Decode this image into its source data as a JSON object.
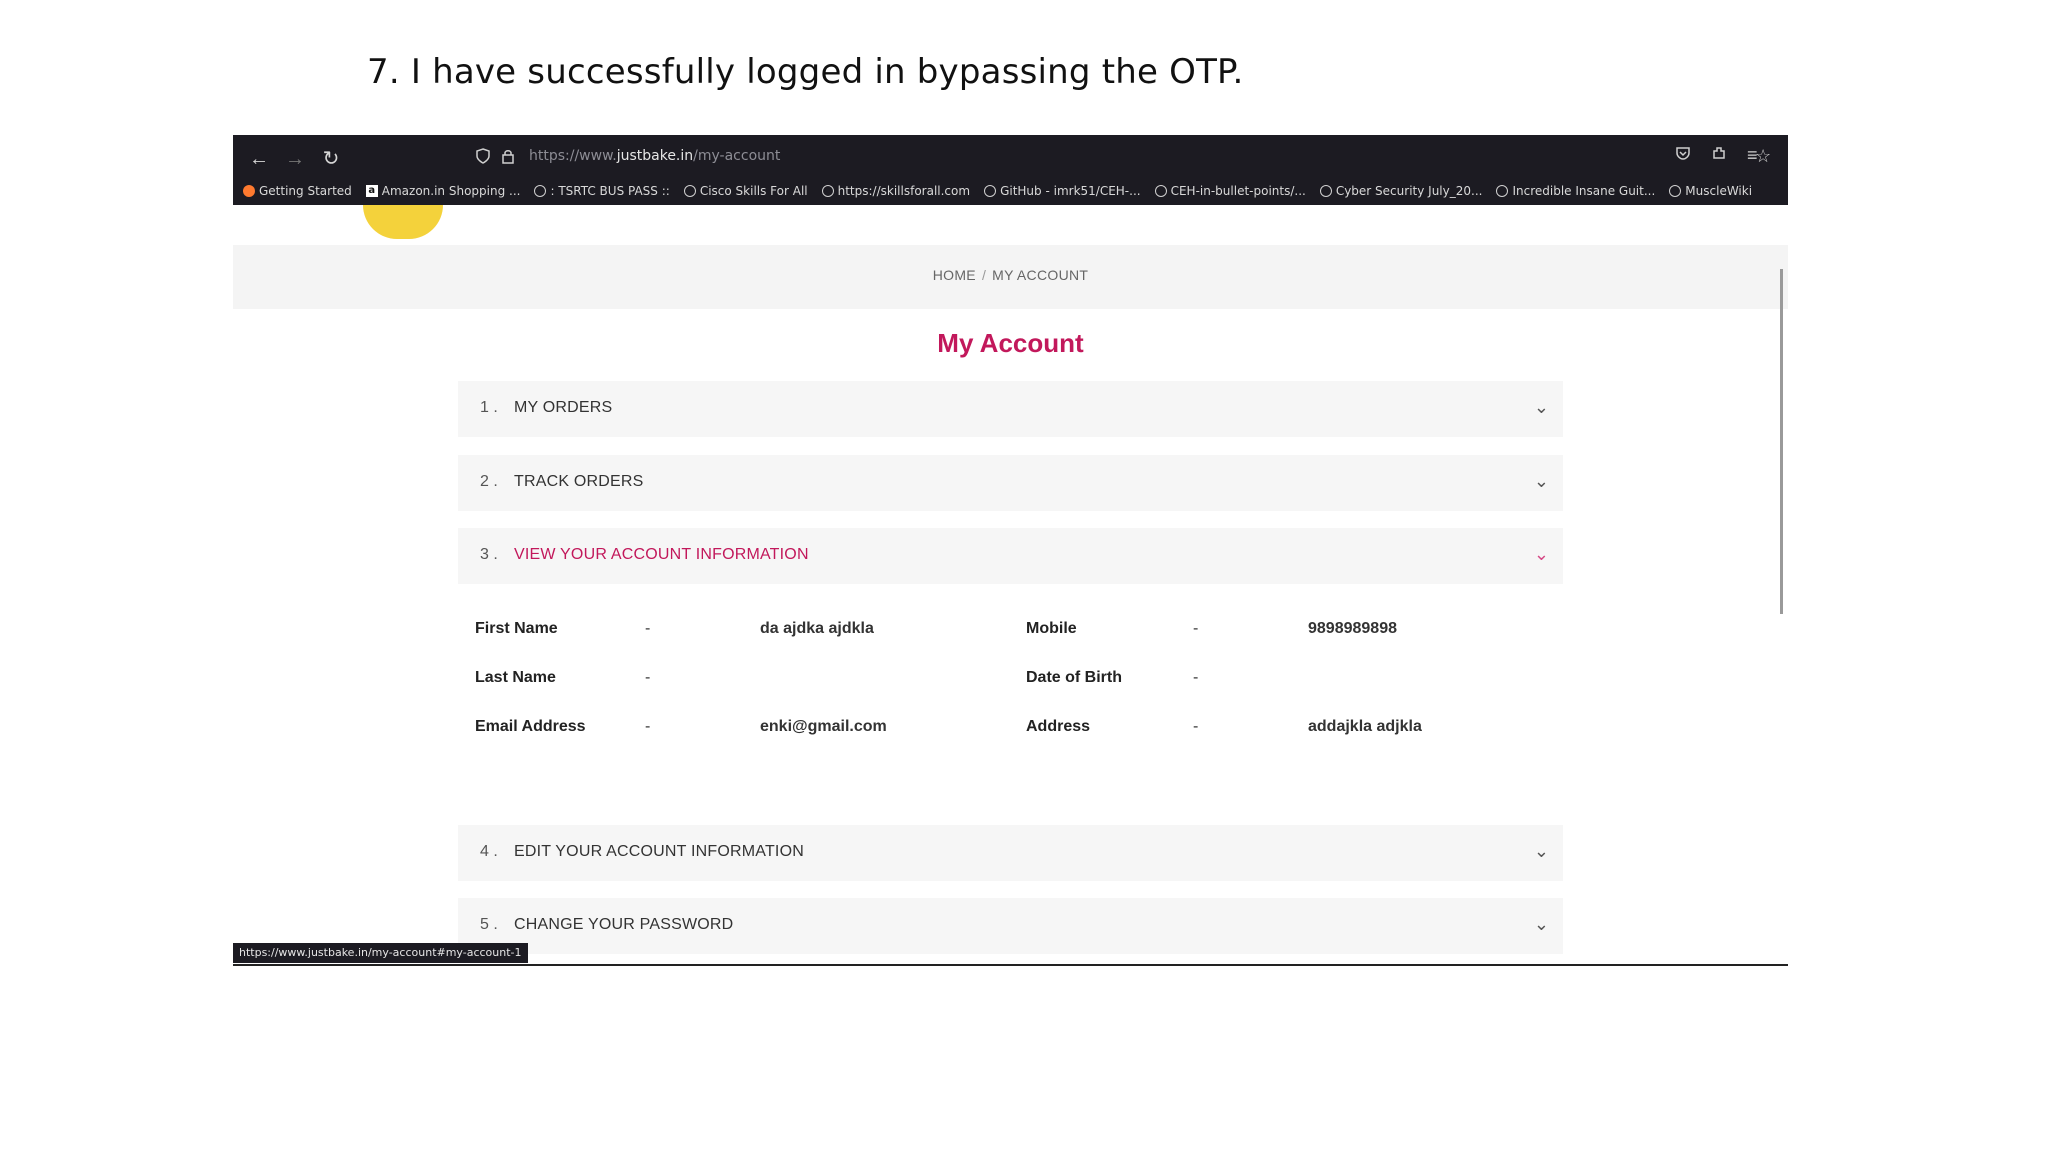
{
  "caption": "7. I have successfully logged in bypassing the OTP.",
  "browser": {
    "url_prefix": "https://www.",
    "url_domain": "justbake.in",
    "url_path": "/my-account",
    "nav": {
      "back": "←",
      "forward": "→",
      "reload": "↻"
    },
    "bookmarks": [
      "Getting Started",
      "Amazon.in Shopping ...",
      ": TSRTC BUS PASS ::",
      "Cisco Skills For All",
      "https://skillsforall.com",
      "GitHub - imrk51/CEH-...",
      "CEH-in-bullet-points/...",
      "Cyber Security July_20...",
      "Incredible Insane Guit...",
      "MuscleWiki"
    ],
    "status_url": "https://www.justbake.in/my-account#my-account-1"
  },
  "page": {
    "breadcrumb_home": "HOME",
    "breadcrumb_sep": "/",
    "breadcrumb_current": "MY ACCOUNT",
    "title": "My Account",
    "sections": [
      {
        "num": "1 .",
        "label": "MY ORDERS",
        "chev": "⌄"
      },
      {
        "num": "2 .",
        "label": "TRACK ORDERS",
        "chev": "⌄"
      },
      {
        "num": "3 .",
        "label": "VIEW YOUR ACCOUNT INFORMATION",
        "chev": "⌄"
      },
      {
        "num": "4 .",
        "label": "EDIT YOUR ACCOUNT INFORMATION",
        "chev": "⌄"
      },
      {
        "num": "5 .",
        "label": "CHANGE YOUR PASSWORD",
        "chev": "⌄"
      }
    ],
    "info": {
      "dash": "-",
      "first_name_label": "First Name",
      "first_name_value": "da ajdka ajdkla",
      "last_name_label": "Last Name",
      "last_name_value": "",
      "email_label": "Email Address",
      "email_value": "enki@gmail.com",
      "mobile_label": "Mobile",
      "mobile_value": "9898989898",
      "dob_label": "Date of Birth",
      "dob_value": "",
      "address_label": "Address",
      "address_value": "addajkla adjkla"
    }
  },
  "colors": {
    "accent": "#c2185b",
    "chrome": "#1c1b22"
  }
}
